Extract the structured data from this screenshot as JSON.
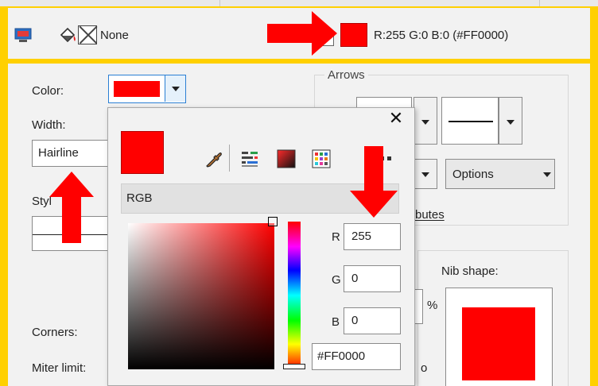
{
  "statusbar": {
    "fill_label": "None",
    "outline_color_text": "R:255 G:0 B:0 (#FF0000)",
    "outline_color": "#ff0000"
  },
  "panel": {
    "color_label": "Color:",
    "width_label": "Width:",
    "width_value": "Hairline",
    "style_label": "Styl",
    "corners_label": "Corners:",
    "miter_label": "Miter limit:",
    "arrows_title": "Arrows",
    "options_label": "Options",
    "attributes_fragment": "butes",
    "nib_shape_label": "Nib shape:",
    "percent_fragment": "%",
    "o_fragment": "o"
  },
  "color_popup": {
    "close_label": "✕",
    "model_label": "RGB",
    "r_label": "R",
    "r_value": "255",
    "g_label": "G",
    "g_value": "0",
    "b_label": "B",
    "b_value": "0",
    "hex_value": "#FF0000",
    "current_color": "#ff0000",
    "icons": [
      "eyedropper-icon",
      "color-sliders-icon",
      "color-viewer-icon",
      "color-palette-icon",
      "more-options-icon"
    ]
  },
  "colors": {
    "accent": "#ffd000",
    "annotation": "#ff0000",
    "focus_border": "#2a7fd4"
  }
}
